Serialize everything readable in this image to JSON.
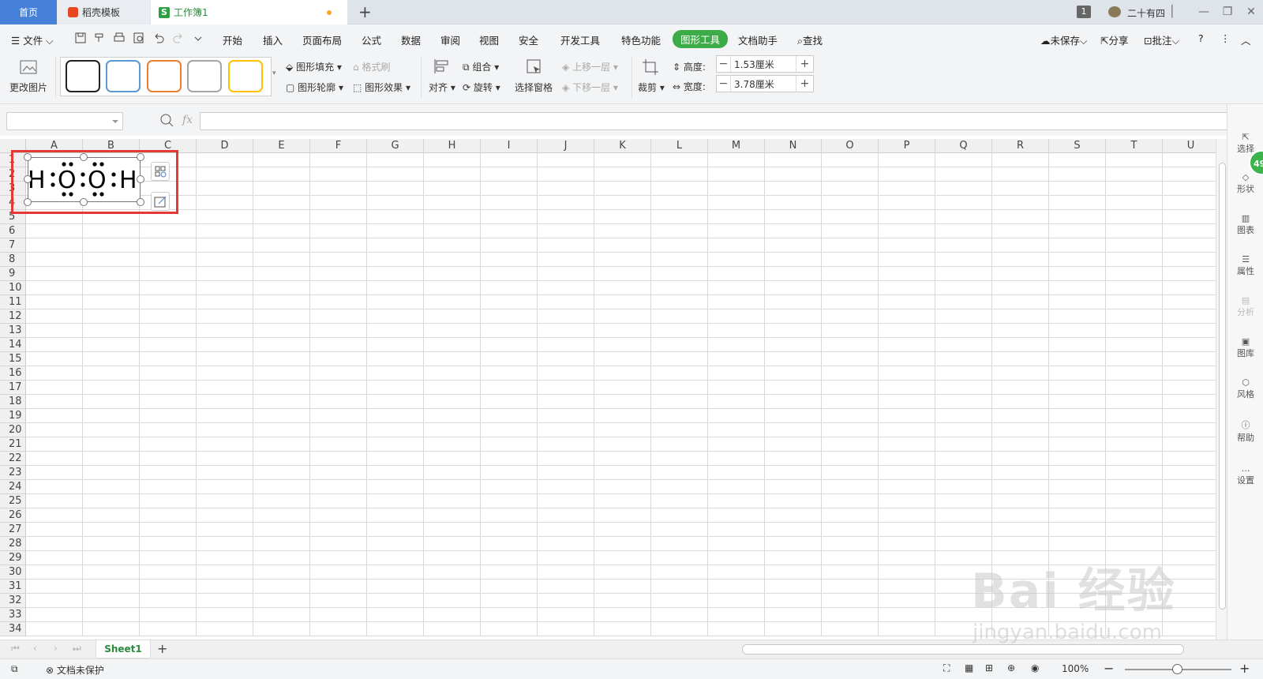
{
  "tabs": {
    "home": "首页",
    "template": "稻壳模板",
    "workbook": "工作簿1"
  },
  "window": {
    "page_count": "1",
    "user": "二十有四"
  },
  "menu": {
    "file": "文件",
    "items": [
      "开始",
      "插入",
      "页面布局",
      "公式",
      "数据",
      "审阅",
      "视图",
      "安全",
      "开发工具",
      "特色功能"
    ],
    "active": "图形工具",
    "doc_helper": "文档助手",
    "search": "查找",
    "unsaved": "未保存",
    "share": "分享",
    "annotate": "批注"
  },
  "ribbon": {
    "change_picture": "更改图片",
    "shape_fill": "图形填充",
    "format_painter": "格式刷",
    "shape_outline": "图形轮廓",
    "shape_effect": "图形效果",
    "align": "对齐",
    "group": "组合",
    "rotate": "旋转",
    "selection_pane": "选择窗格",
    "bring_forward": "上移一层",
    "send_backward": "下移一层",
    "crop": "裁剪",
    "height_label": "高度:",
    "height_value": "1.53厘米",
    "width_label": "宽度:",
    "width_value": "3.78厘米",
    "style_colors": [
      "#222222",
      "#5b9bd5",
      "#ed7d31",
      "#a5a5a5",
      "#ffc000"
    ]
  },
  "formula": {
    "fx": "fx",
    "name_box": "",
    "value": ""
  },
  "grid": {
    "columns": [
      "A",
      "B",
      "C",
      "D",
      "E",
      "F",
      "G",
      "H",
      "I",
      "J",
      "K",
      "L",
      "M",
      "N",
      "O",
      "P",
      "Q",
      "R",
      "S",
      "T",
      "U"
    ],
    "rows": [
      "1",
      "2",
      "3",
      "4",
      "5",
      "6",
      "7",
      "8",
      "9",
      "10",
      "11",
      "12",
      "13",
      "14",
      "15",
      "16",
      "17",
      "18",
      "19",
      "20",
      "21",
      "22",
      "23",
      "24",
      "25",
      "26",
      "27",
      "28",
      "29",
      "30",
      "31",
      "32",
      "33",
      "34"
    ]
  },
  "shape": {
    "formula": "H:Ö:Ö:H"
  },
  "right_panel": {
    "items": [
      "选择",
      "形状",
      "图表",
      "属性",
      "分析",
      "图库",
      "风格",
      "帮助",
      "设置"
    ],
    "badge": "49"
  },
  "sheets": {
    "tab": "Sheet1"
  },
  "status": {
    "protect": "文档未保护",
    "zoom": "100%"
  },
  "watermark": {
    "brand": "Bai 经验",
    "url": "jingyan.baidu.com"
  }
}
